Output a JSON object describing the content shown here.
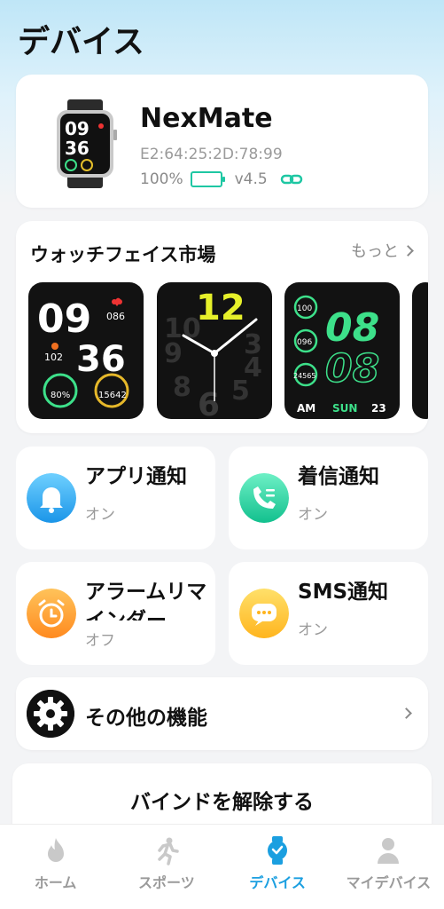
{
  "header": {
    "title": "デバイス"
  },
  "device": {
    "name": "NexMate",
    "mac": "E2:64:25:2D:78:99",
    "battery": "100%",
    "battery_level": 1.0,
    "version": "v4.5",
    "watch_time_hour": "09",
    "watch_time_min": "36"
  },
  "watch_faces": {
    "title": "ウォッチフェイス市場",
    "more_label": "もっと",
    "faces": [
      {
        "hour": "09",
        "min": "36",
        "heart": "086",
        "flame": "102",
        "left_ring": "80%",
        "right_ring": "15642"
      },
      {
        "hour": "12"
      },
      {
        "hour": "08",
        "min": "08",
        "top": "100",
        "mid": "096",
        "bottom": "24565",
        "ampm": "AM",
        "day": "SUN",
        "date": "23"
      }
    ]
  },
  "features": {
    "app_notify": {
      "label": "アプリ通知",
      "status": "オン"
    },
    "call_notify": {
      "label": "着信通知",
      "status": "オン"
    },
    "alarm": {
      "label": "アラームリマインダー",
      "status": "オフ"
    },
    "sms_notify": {
      "label": "SMS通知",
      "status": "オン"
    }
  },
  "other": {
    "label": "その他の機能"
  },
  "unbind": {
    "label": "バインドを解除する"
  },
  "nav": {
    "home": "ホーム",
    "sports": "スポーツ",
    "device": "デバイス",
    "my_device": "マイデバイス"
  },
  "colors": {
    "accent": "#1b9fe0",
    "battery": "#1ec7a3",
    "face_green": "#3de08a",
    "face_yellow": "#e6f02a"
  }
}
